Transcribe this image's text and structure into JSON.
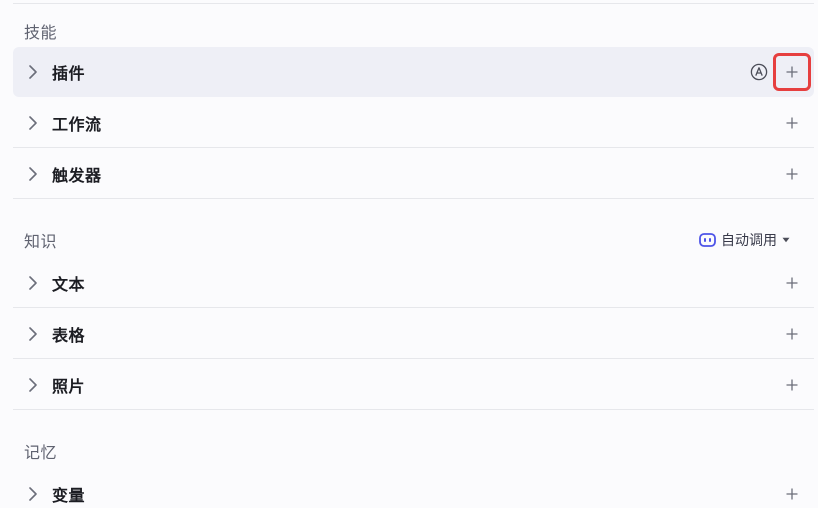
{
  "sections": {
    "skills": {
      "title": "技能",
      "items": [
        {
          "label": "插件"
        },
        {
          "label": "工作流"
        },
        {
          "label": "触发器"
        }
      ]
    },
    "knowledge": {
      "title": "知识",
      "auto_call_label": "自动调用",
      "items": [
        {
          "label": "文本"
        },
        {
          "label": "表格"
        },
        {
          "label": "照片"
        }
      ]
    },
    "memory": {
      "title": "记忆",
      "items": [
        {
          "label": "变量"
        }
      ]
    }
  },
  "icons": {
    "expand": "chevron-right-icon",
    "add": "plus-icon",
    "auto": "circle-a-icon",
    "bot": "bot-icon",
    "caret": "caret-down-icon"
  },
  "colors": {
    "highlight_border": "#e63f3f",
    "hover_row": "#eeeff6",
    "accent": "#4d53e8"
  }
}
